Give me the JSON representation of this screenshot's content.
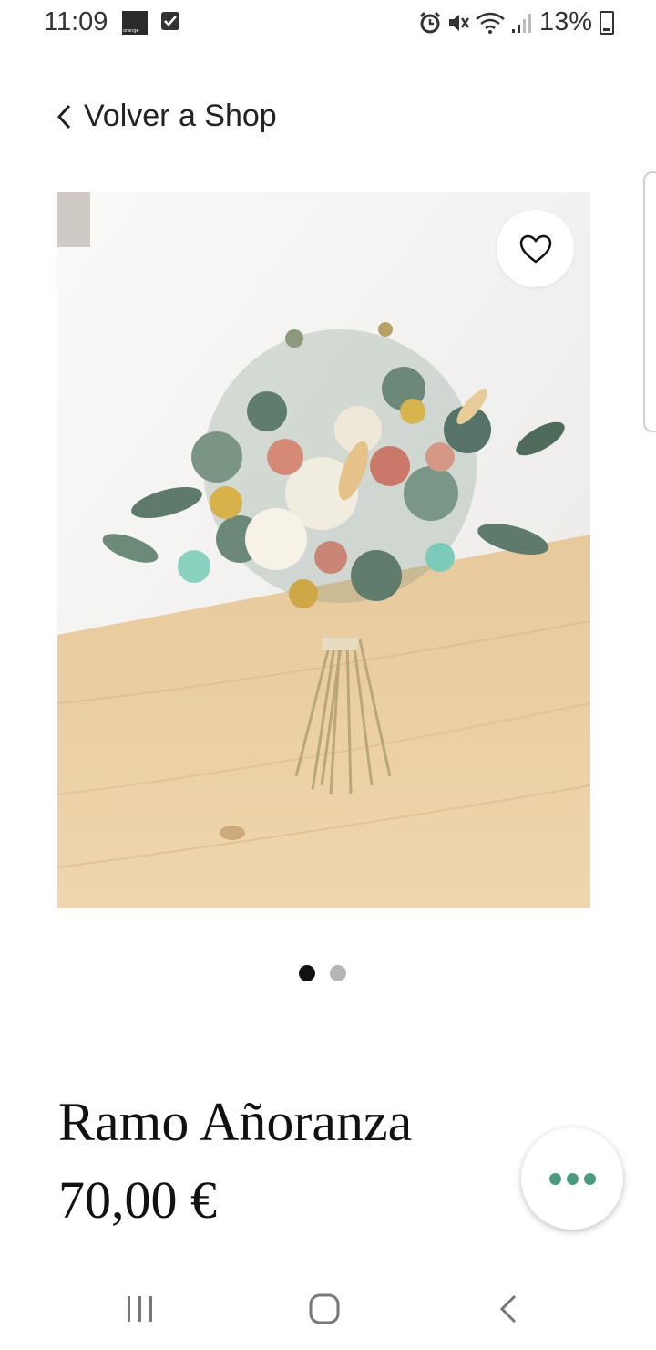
{
  "status_bar": {
    "time": "11:09",
    "carrier_logo": "orange",
    "battery": "13%"
  },
  "nav": {
    "back_label": "Volver a Shop"
  },
  "gallery": {
    "image_alt": "Dried flower bouquet on a wooden table",
    "active_index": 0,
    "count": 2,
    "dot_active_color": "#111111",
    "dot_inactive_color": "#b5b5b5"
  },
  "product": {
    "title": "Ramo Añoranza",
    "price": "70,00 €"
  },
  "colors": {
    "fab_accent": "#4a9c80"
  },
  "icons": {
    "favorite": "heart-outline-icon",
    "back": "chevron-left-icon",
    "more": "more-horizontal-icon"
  }
}
